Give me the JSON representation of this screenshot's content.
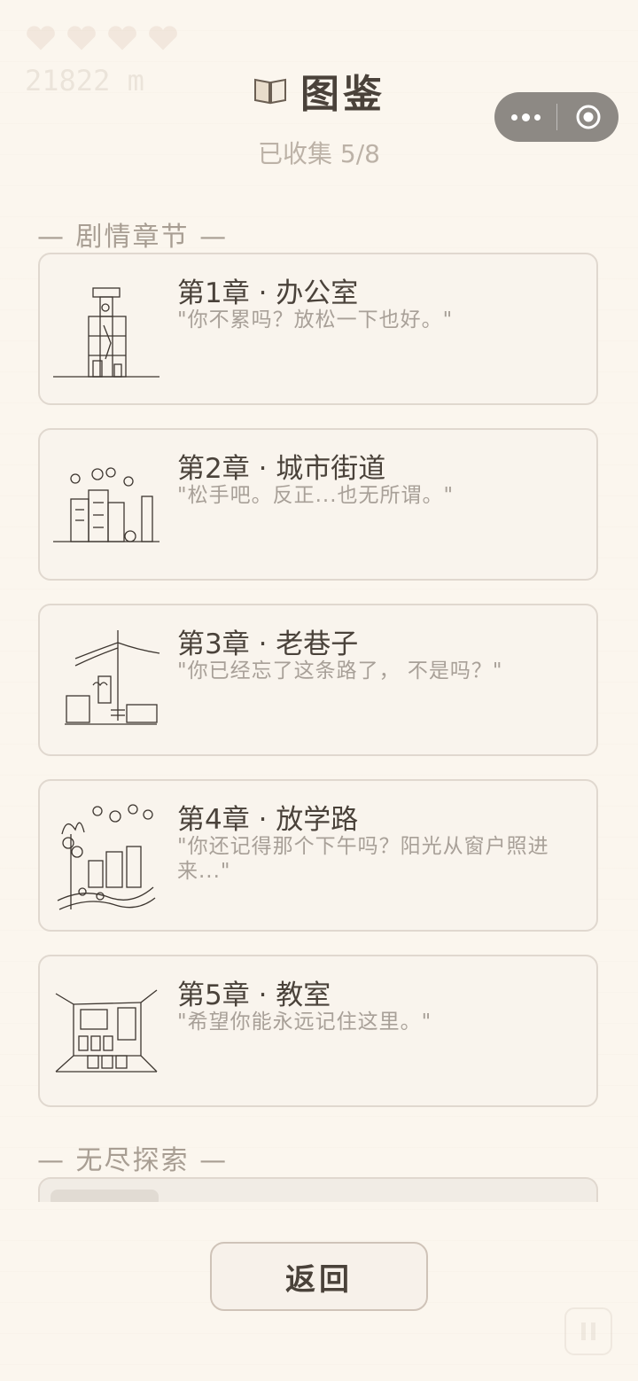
{
  "hud": {
    "distance": "21822 m",
    "lives": 4
  },
  "header": {
    "title": "图鉴",
    "collected": "已收集 5/8"
  },
  "sections": {
    "story": "— 剧情章节 —",
    "endless": "— 无尽探索 —"
  },
  "chapters": [
    {
      "title": "第1章 · 办公室",
      "quote": "\"你不累吗？放松一下也好。\"",
      "icon": "office-sketch"
    },
    {
      "title": "第2章 · 城市街道",
      "quote": "\"松手吧。反正...也无所谓。\"",
      "icon": "city-street-sketch"
    },
    {
      "title": "第3章 · 老巷子",
      "quote": "\"你已经忘了这条路了， 不是吗？\"",
      "icon": "old-alley-sketch"
    },
    {
      "title": "第4章 · 放学路",
      "quote": "\"你还记得那个下午吗？阳光从窗户照进来...\"",
      "icon": "school-road-sketch"
    },
    {
      "title": "第5章 · 教室",
      "quote": "\"希望你能永远记住这里。\"",
      "icon": "classroom-sketch"
    }
  ],
  "buttons": {
    "back": "返回"
  },
  "colors": {
    "background": "#fbf6ee",
    "card_border": "#e0d8cf",
    "text": "#4a423a",
    "muted": "#a8a098",
    "capsule": "#8d8984"
  }
}
